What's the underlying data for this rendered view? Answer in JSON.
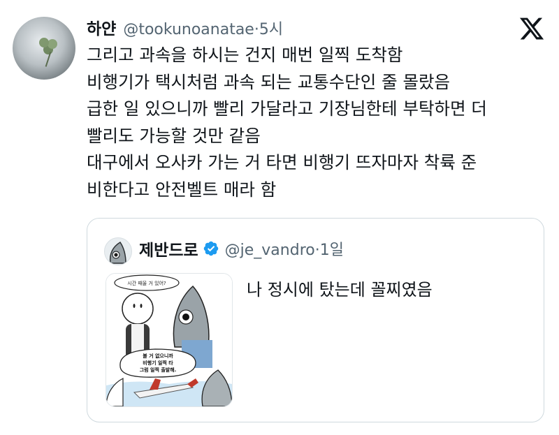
{
  "tweet": {
    "display_name": "하얀",
    "handle": "@tookunoanatae",
    "separator": "·",
    "time": "5시",
    "lines": [
      "그리고 과속을 하시는 건지 매번 일찍 도착함",
      "비행기가 택시처럼 과속 되는 교통수단인 줄 몰랐음",
      "급한 일 있으니까 빨리 가달라고 기장님한테 부탁하면 더",
      "빨리도 가능할 것만 같음",
      "대구에서 오사카 가는 거 타면 비행기 뜨자마자 착륙 준",
      "비한다고 안전벨트 매라 함"
    ],
    "avatar_icon": "profile-photo-clover"
  },
  "brand": {
    "logo_icon": "x-logo-icon"
  },
  "quote": {
    "display_name": "제반드로",
    "verified_icon": "verified-badge-icon",
    "handle": "@je_vandro",
    "separator": "·",
    "time": "1일",
    "text": "나 정시에 탔는데 꼴찌였음",
    "image": {
      "bubble_top": "시간 때울 거 있어?",
      "bubble_main_lines": [
        "볼 거 없으니까",
        "비행기 일찍 타",
        "그럼 일찍 출발해."
      ]
    }
  },
  "colors": {
    "text_primary": "#0f1419",
    "text_secondary": "#536471",
    "border": "#cfd9de",
    "verified_blue": "#1d9bf0"
  }
}
